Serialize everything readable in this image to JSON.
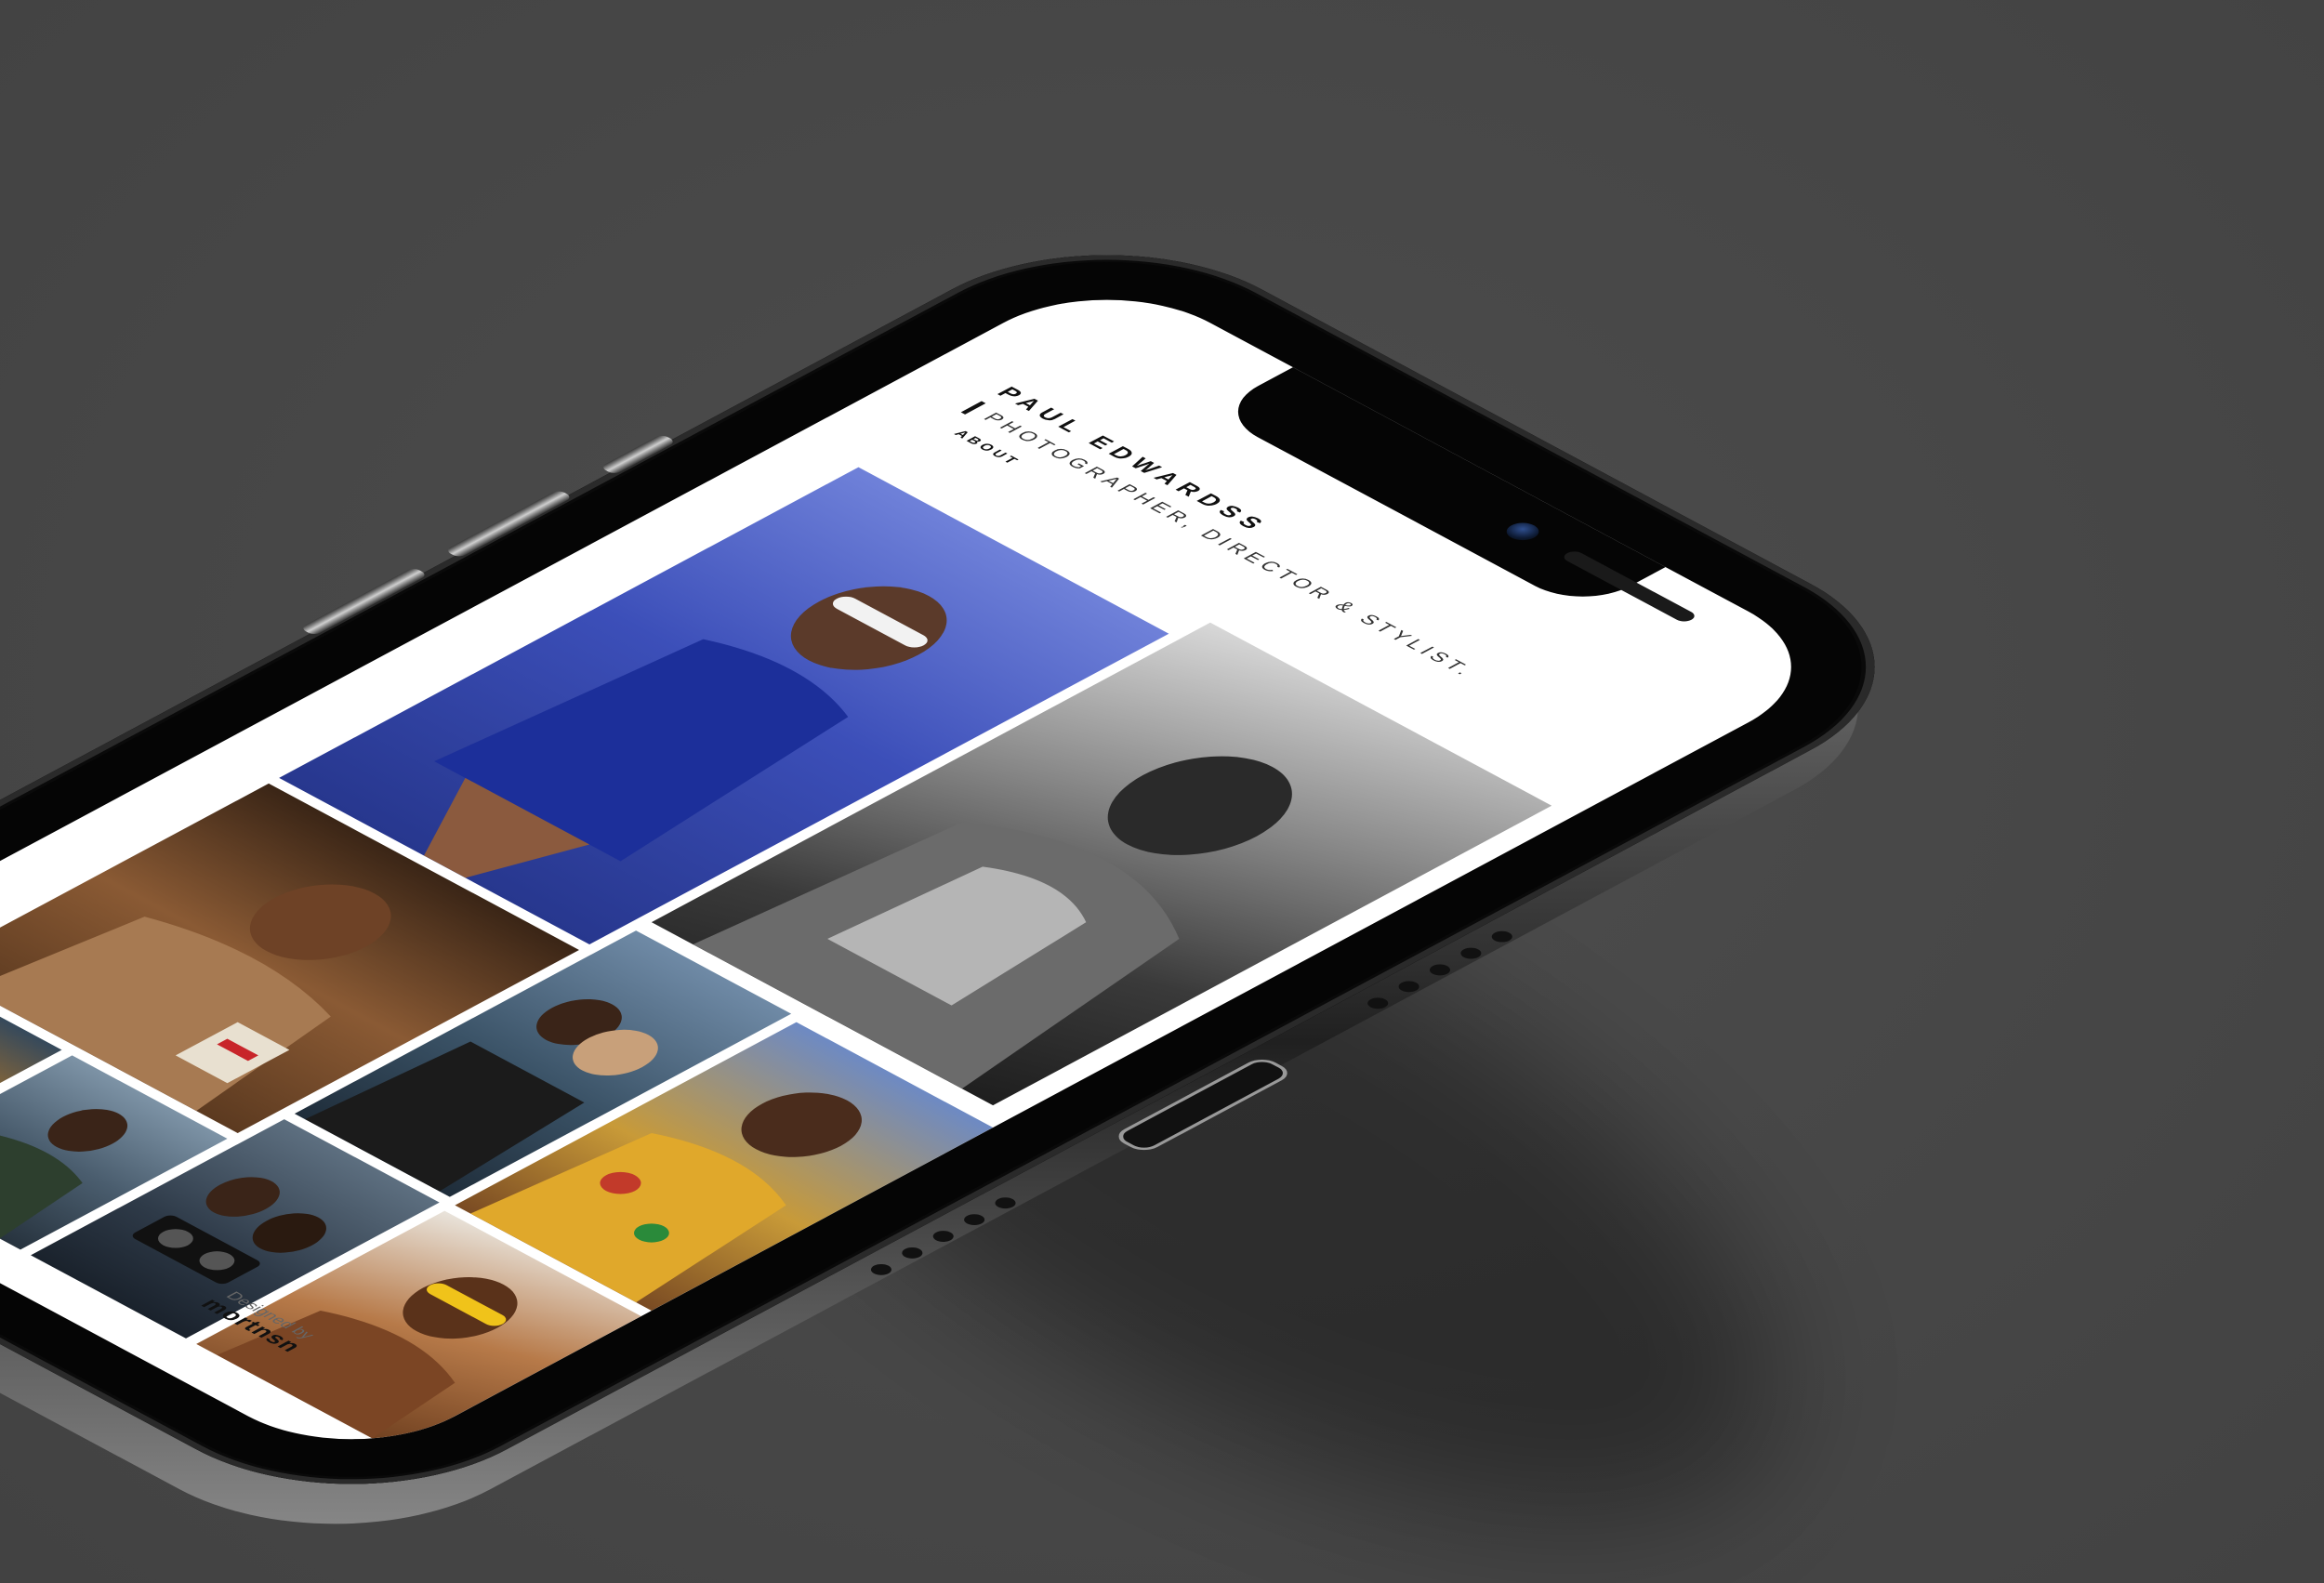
{
  "header": {
    "site_name": "PAUL EDWARDSS",
    "tagline": "PHOTOGRAPHER, DIRECTOR & STYLIST.",
    "nav_about": "ABOUT"
  },
  "gallery": {
    "photos": [
      {
        "id": "portrait-blazer-bw",
        "bg": "#8c8c8c"
      },
      {
        "id": "swimsuit-blue-sunglasses",
        "bg": "#3b4db8"
      },
      {
        "id": "floral-shirt-sky",
        "bg": "#c79a3a"
      },
      {
        "id": "couple-studio-blue",
        "bg": "#3d5570"
      },
      {
        "id": "yellow-sunglasses-smile",
        "bg": "#b5713d"
      },
      {
        "id": "warm-portrait-bucket",
        "bg": "#7a4d2a"
      },
      {
        "id": "boombox-duo",
        "bg": "#2e3a4a"
      },
      {
        "id": "woman-seated-jacket",
        "bg": "#4a5d6e"
      },
      {
        "id": "orange-feathers-car",
        "bg": "#d98a1e"
      }
    ]
  },
  "footer": {
    "credit_label": "Designed by",
    "credit_brand": "mortnsn"
  },
  "colors": {
    "background": "#484848",
    "screen": "#ffffff",
    "text": "#111111"
  }
}
